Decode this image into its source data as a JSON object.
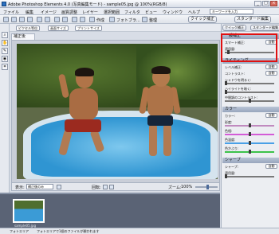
{
  "title": "Adobe Photoshop Elements 4.0 (写真編集モード) - sample05.jpg @ 100%(RGB/8)",
  "window_buttons": [
    "_",
    "□",
    "×"
  ],
  "menu": [
    "ファイル",
    "編集",
    "イメージ",
    "画質調整",
    "レイヤー",
    "選択範囲",
    "フィルタ",
    "ビュー",
    "ウィンドウ",
    "ヘルプ"
  ],
  "help_search": {
    "placeholder": "キーワードを入力"
  },
  "toolbar": {
    "create": "作成",
    "photo": "フォトブラ...",
    "organize": "整理",
    "quick_fix": "クイック補正",
    "standard_edit": "スタンダード編集"
  },
  "options_bar": [
    "ピクセル等倍",
    "画面サイズ",
    "プリントサイズ"
  ],
  "doc_tab": "補正後",
  "status": {
    "display_label": "表示:",
    "display_value": "補正後のみ",
    "rotate_label": "回転:",
    "zoom_label": "ズーム:",
    "zoom_value": "100%",
    "zoom_level": 0.55
  },
  "photobin": {
    "thumb_label": "sample05.jpg"
  },
  "bottom": {
    "organizer": "フォトエリア",
    "bin_status": "フォトエリアで1個のファイルが開かれます"
  },
  "panel": {
    "sections": [
      {
        "title": "一般補正",
        "rows": [
          {
            "label": "スマート補正:",
            "auto": "自動"
          },
          {
            "label": "適用量:",
            "slider": 0.05,
            "color": "#7a7a7a"
          }
        ]
      },
      {
        "title": "ライティング",
        "rows": [
          {
            "label": "レベル補正:",
            "auto": "自動"
          },
          {
            "label": "コントラスト:",
            "auto": "自動"
          },
          {
            "label": "シャドウを明るく:",
            "slider": 0.0,
            "color": "#7a7a7a"
          },
          {
            "label": "ハイライトを暗く:",
            "slider": 0.0,
            "color": "#7a7a7a"
          },
          {
            "label": "中間調のコントラスト:",
            "slider": 0.5,
            "color": "#7a7a7a"
          }
        ]
      },
      {
        "title": "カラー",
        "rows": [
          {
            "label": "カラー:",
            "auto": "自動"
          },
          {
            "label": "彩度:",
            "slider": 0.5,
            "color": "#c08abf"
          },
          {
            "label": "色相:",
            "slider": 0.5,
            "color": "#d35cd7"
          },
          {
            "label": "色温度:",
            "slider": 0.5,
            "color": "#4aa0e6"
          },
          {
            "label": "色かぶり:",
            "slider": 0.5,
            "color": "#3cc24a"
          }
        ]
      },
      {
        "title": "シャープ",
        "rows": [
          {
            "label": "シャープ:",
            "auto": "自動"
          },
          {
            "label": "適用量:",
            "slider": 0.0,
            "color": "#7a7a7a"
          }
        ]
      }
    ]
  }
}
